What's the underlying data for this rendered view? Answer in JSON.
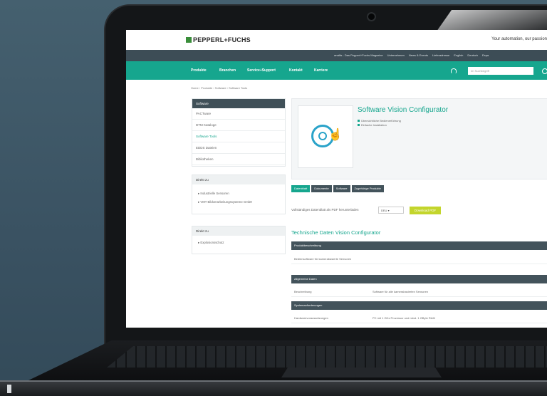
{
  "site": {
    "logo": "PEPPERL+FUCHS",
    "slogan": "Your automation, our passion",
    "util_links": [
      "analiis - Das Pepperl+Fuchs Magazine",
      "Unternehmen",
      "News & Events",
      "Lieferadresse",
      "English",
      "Deutsch",
      "Espa"
    ],
    "nav": [
      "Produkte",
      "Branchen",
      "Service+Support",
      "Kontakt",
      "Karriere"
    ],
    "search_placeholder": "Im Suchbegriff",
    "breadcrumb": "Home  ›  Produkte  ›  Software  ›  Software Tools",
    "colors": {
      "brand": "#16a68e",
      "dark": "#43535b",
      "button": "#c3d52c"
    }
  },
  "sidebar": {
    "head": "Software",
    "items": [
      "PACTware",
      "DTM Kataloge",
      "Software Tools",
      "EDDS Dateien",
      "Bibliotheken"
    ],
    "active_index": 2,
    "box2_head": "Direkt zu",
    "box2_links": [
      "Industrielle Sensoren",
      "VMT Bildverarbeitungssysteme GmbH"
    ],
    "box3_head": "Direkt zu",
    "box3_links": [
      "Explosionsschutz"
    ]
  },
  "product": {
    "title": "Software Vision Configurator",
    "bullets": [
      "Übersichtliche Bedienerführung",
      "Einfache Installation"
    ]
  },
  "tabs": [
    "Datenblatt",
    "Dokumente",
    "Software",
    "Zugehörige Produkte"
  ],
  "pdf": {
    "label": "Vollständiges Datenblatt als PDF herunterladen",
    "select": "DEU",
    "button": "Download PDF"
  },
  "tech": {
    "title": "Technische Daten Vision Configurator",
    "sections": [
      {
        "head": "Produktbeschreibung",
        "rows": [
          {
            "k": "Bediensoftware für kamerabasierte Sensoren",
            "v": ""
          }
        ]
      },
      {
        "head": "Allgemeine Daten",
        "rows": [
          {
            "k": "Beschreibung",
            "v": "Software für alle kamerabasierten Sensoren"
          }
        ]
      },
      {
        "head": "Systemanforderungen",
        "rows": [
          {
            "k": "Hardwarevoraussetzungen",
            "v": "PC mit 1 GHz Prozessor und mind. 1 GByte RAM"
          }
        ]
      }
    ]
  }
}
